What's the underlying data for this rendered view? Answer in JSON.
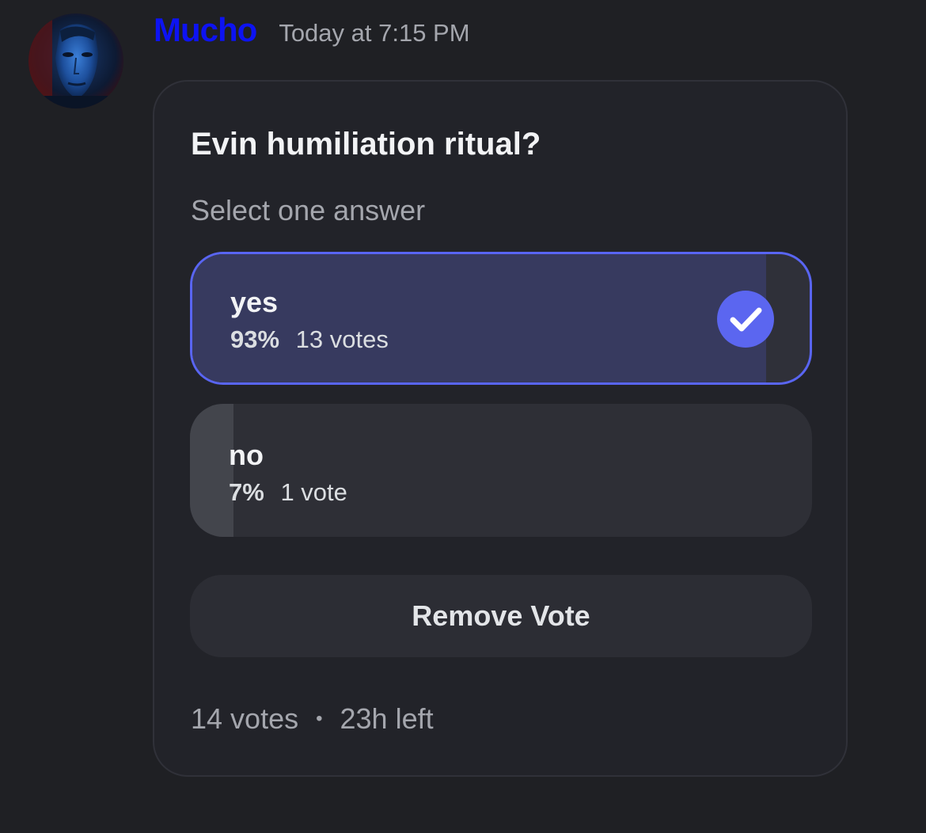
{
  "message": {
    "author": "Mucho",
    "author_color": "#0d13f2",
    "timestamp": "Today at 7:15 PM"
  },
  "poll": {
    "question": "Evin humiliation ritual?",
    "instruction": "Select one answer",
    "answers": [
      {
        "label": "yes",
        "percent": "93%",
        "votes": "13 votes",
        "fraction": 0.93,
        "selected": true
      },
      {
        "label": "no",
        "percent": "7%",
        "votes": "1 vote",
        "fraction": 0.07,
        "selected": false
      }
    ],
    "remove_vote_label": "Remove Vote",
    "total_votes": "14 votes",
    "separator": "•",
    "time_left": "23h left",
    "accent_color": "#5865f2"
  }
}
